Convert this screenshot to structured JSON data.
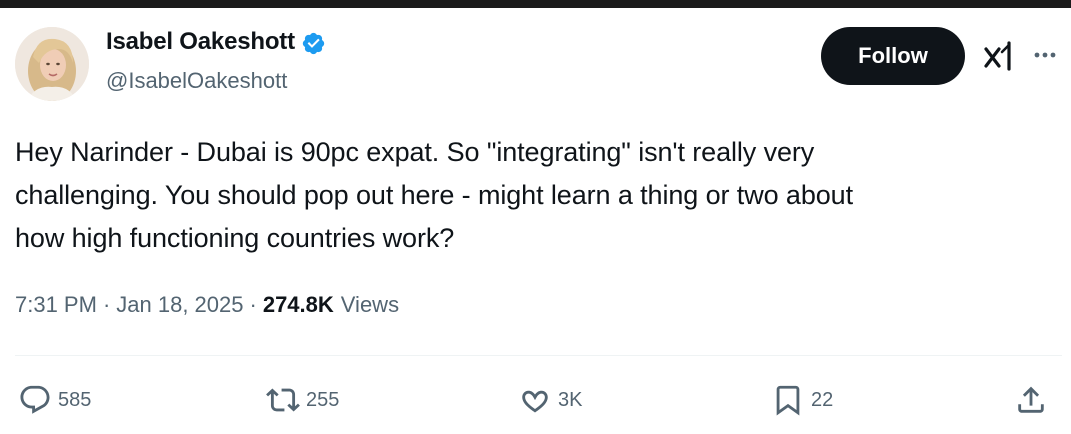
{
  "author": {
    "display_name": "Isabel Oakeshott",
    "handle": "@IsabelOakeshott",
    "verified": true
  },
  "header": {
    "follow_label": "Follow"
  },
  "tweet": {
    "text_lines": [
      "Hey Narinder - Dubai is 90pc expat. So \"integrating\" isn't really very",
      "challenging. You should pop out here - might learn a thing or two about",
      "how high functioning countries work?"
    ],
    "time": "7:31 PM",
    "date": "Jan 18, 2025",
    "views_count": "274.8K",
    "views_label": "Views"
  },
  "actions": {
    "replies": "585",
    "reposts": "255",
    "likes": "3K",
    "bookmarks": "22"
  },
  "colors": {
    "text": "#0f1419",
    "secondary": "#536471",
    "verified_blue": "#1d9bf0",
    "follow_bg": "#0f1419"
  },
  "icons": [
    "verified-badge-icon",
    "grok-icon",
    "more-icon",
    "reply-icon",
    "repost-icon",
    "like-icon",
    "bookmark-icon",
    "share-icon"
  ]
}
